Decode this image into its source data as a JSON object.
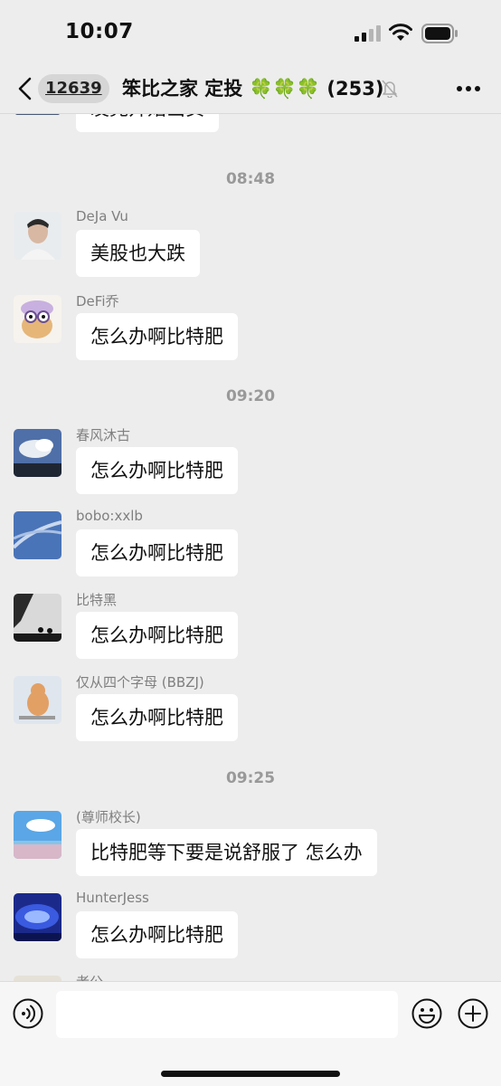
{
  "status_bar": {
    "time": "10:07"
  },
  "nav": {
    "unread_count": "12639",
    "title": "笨比之家 定投",
    "title_emoji": "🍀🍀🍀",
    "member_count": "(253)"
  },
  "chat": {
    "partial_top_message": "发完开始出货",
    "dividers": [
      "08:48",
      "09:20",
      "09:25"
    ],
    "messages": [
      {
        "sender": "DeJa Vu",
        "text": "美股也大跌"
      },
      {
        "sender": "DeFi乔",
        "text": "怎么办啊比特肥"
      },
      {
        "sender": "春风沐古",
        "text": "怎么办啊比特肥"
      },
      {
        "sender": "bobo:xxlb",
        "text": "怎么办啊比特肥"
      },
      {
        "sender": "比特黑",
        "text": "怎么办啊比特肥"
      },
      {
        "sender": "仅从四个字母 (BBZJ)",
        "text": "怎么办啊比特肥"
      },
      {
        "sender": "(尊师校长)",
        "text": "比特肥等下要是说舒服了 怎么办"
      },
      {
        "sender": "HunterJess",
        "text": "怎么办啊比特肥"
      },
      {
        "sender": "老公",
        "text": ""
      }
    ]
  },
  "input": {
    "value": "",
    "placeholder": ""
  },
  "icons": {
    "back": "chevron-left-icon",
    "mute": "bell-slash-icon",
    "more": "more-dots-icon",
    "voice": "voice-icon",
    "emoji": "emoji-icon",
    "plus": "plus-icon"
  },
  "colors": {
    "background": "#ededed",
    "bubble": "#ffffff",
    "clover": "#3fa64a",
    "meta_text": "#999999"
  }
}
